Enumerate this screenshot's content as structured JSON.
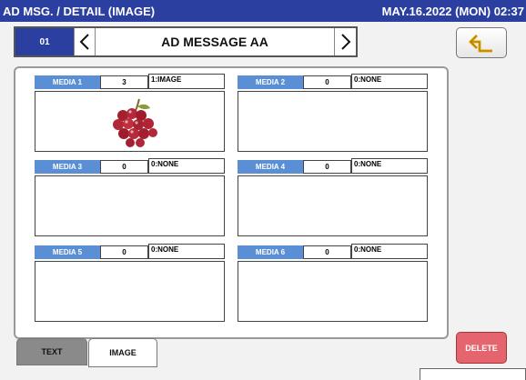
{
  "header": {
    "title": "AD MSG. / DETAIL (IMAGE)",
    "datetime": "MAY.16.2022 (MON) 02:37"
  },
  "nav": {
    "number": "01",
    "message_name": "AD MESSAGE AA",
    "prev_icon": "chevron-left-icon",
    "next_icon": "chevron-right-icon"
  },
  "back_icon": "return-arrow-icon",
  "media": [
    {
      "label": "MEDIA 1",
      "count": "3",
      "type": "1:IMAGE",
      "thumbnail": "grapes-image"
    },
    {
      "label": "MEDIA 2",
      "count": "0",
      "type": "0:NONE"
    },
    {
      "label": "MEDIA 3",
      "count": "0",
      "type": "0:NONE"
    },
    {
      "label": "MEDIA 4",
      "count": "0",
      "type": "0:NONE"
    },
    {
      "label": "MEDIA 5",
      "count": "0",
      "type": "0:NONE"
    },
    {
      "label": "MEDIA 6",
      "count": "0",
      "type": "0:NONE"
    }
  ],
  "tabs": [
    {
      "label": "TEXT",
      "active": false
    },
    {
      "label": "IMAGE",
      "active": true
    }
  ],
  "delete_label": "DELETE",
  "colors": {
    "header_bg": "#2a3fa0",
    "media_label_bg": "#5a8fd6",
    "delete_bg": "#e4656e"
  }
}
